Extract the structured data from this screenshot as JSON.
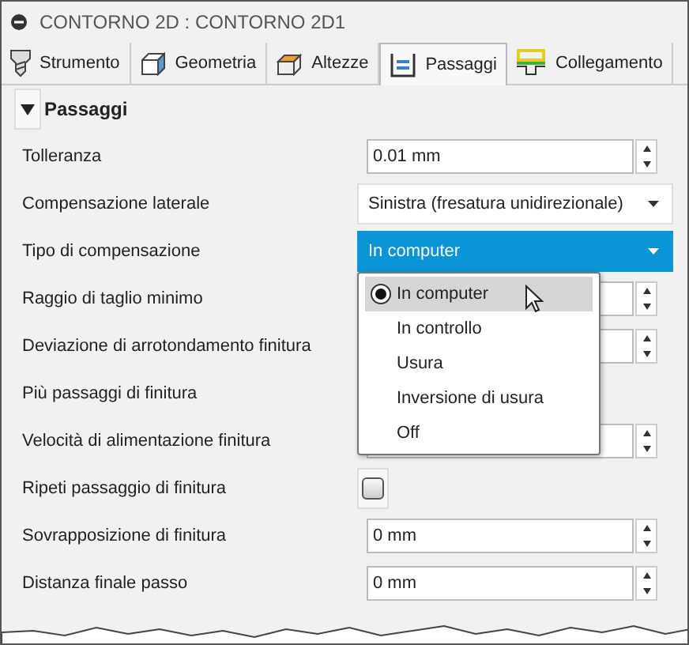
{
  "window": {
    "title": "CONTORNO 2D : CONTORNO 2D1"
  },
  "tabs": [
    {
      "label": "Strumento",
      "selected": false,
      "kind": "tool"
    },
    {
      "label": "Geometria",
      "selected": false,
      "kind": "geometry"
    },
    {
      "label": "Altezze",
      "selected": false,
      "kind": "heights"
    },
    {
      "label": "Passaggi",
      "selected": true,
      "kind": "passes"
    },
    {
      "label": "Collegamento",
      "selected": false,
      "kind": "linking"
    }
  ],
  "section": {
    "title": "Passaggi",
    "expanded": true
  },
  "rows": [
    {
      "label": "Tolleranza",
      "kind": "spin",
      "value": "0.01 mm"
    },
    {
      "label": "Compensazione laterale",
      "kind": "select",
      "value": "Sinistra (fresatura unidirezionale)",
      "open": false
    },
    {
      "label": "Tipo di compensazione",
      "kind": "select",
      "value": "In computer",
      "open": true
    },
    {
      "label": "Raggio di taglio minimo",
      "kind": "spin"
    },
    {
      "label": "Deviazione di arrotondamento finitura",
      "kind": "spin"
    },
    {
      "label": "Più passaggi di finitura",
      "kind": "checkbox"
    },
    {
      "label": "Velocità di alimentazione finitura",
      "kind": "spin"
    },
    {
      "label": "Ripeti passaggio di finitura",
      "kind": "checkbox",
      "checked": false
    },
    {
      "label": "Sovrapposizione di finitura",
      "kind": "spin",
      "value": "0 mm"
    },
    {
      "label": "Distanza finale passo",
      "kind": "spin",
      "value": "0 mm"
    }
  ],
  "dropdown": {
    "options": [
      {
        "label": "In computer",
        "selected": true
      },
      {
        "label": "In controllo",
        "selected": false
      },
      {
        "label": "Usura",
        "selected": false
      },
      {
        "label": "Inversione di usura",
        "selected": false
      },
      {
        "label": "Off",
        "selected": false
      }
    ]
  }
}
